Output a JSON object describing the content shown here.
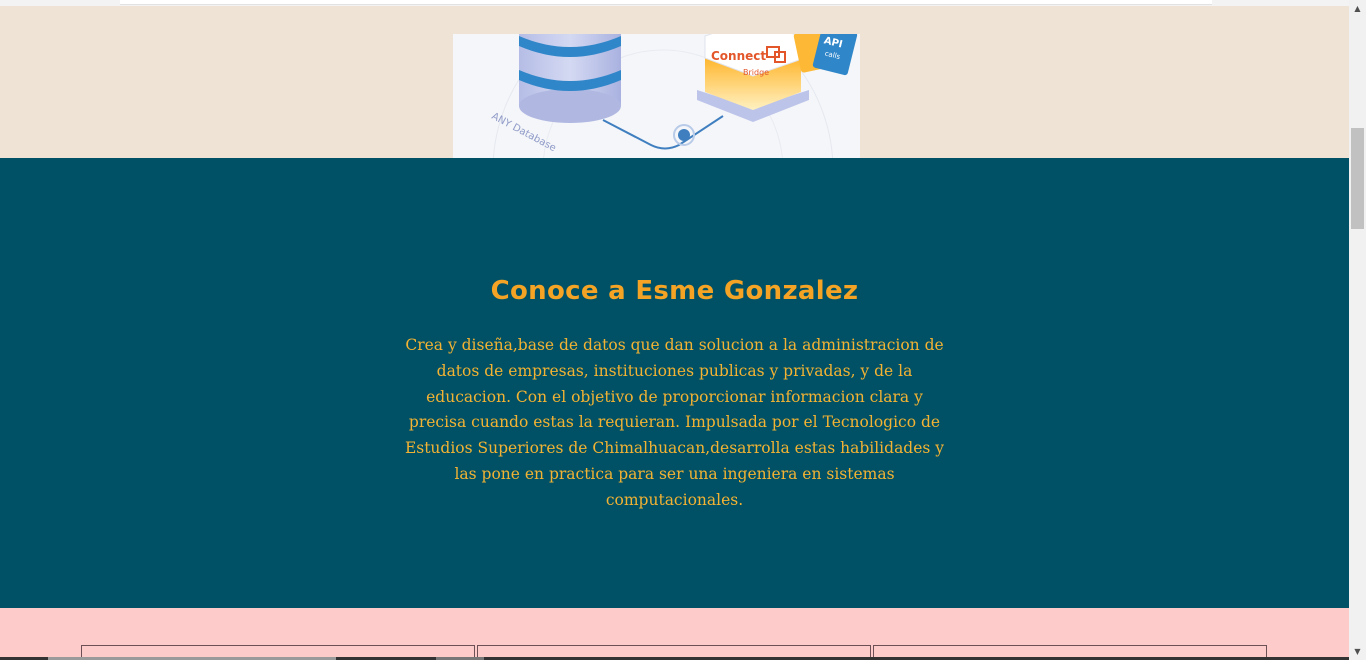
{
  "hero": {
    "illustration": {
      "logo_text": "Connect",
      "logo_subtext": "Bridge",
      "badge_text": "API",
      "badge_subtext": "calls",
      "database_caption": "ANY Database"
    }
  },
  "about": {
    "title": "Conoce a Esme Gonzalez",
    "description": "Crea y diseña,base de datos que dan solucion a la administracion de datos de empresas, instituciones publicas y privadas, y de la educacion. Con el objetivo de proporcionar informacion clara y precisa cuando estas la requieran. Impulsada por el Tecnologico de Estudios Superiores de Chimalhuacan,desarrolla estas habilidades y las pone en practica para ser una ingeniera en sistemas computacionales."
  },
  "services": {
    "cards": [
      {},
      {},
      {}
    ]
  },
  "scrollbar": {
    "up_icon": "scroll-up-arrow",
    "down_icon": "scroll-down-arrow"
  },
  "colors": {
    "hero_bg": "#efe3d6",
    "about_bg": "#005165",
    "title": "#f4a325",
    "body_text": "#f2b233",
    "services_bg": "#fecbcb"
  }
}
